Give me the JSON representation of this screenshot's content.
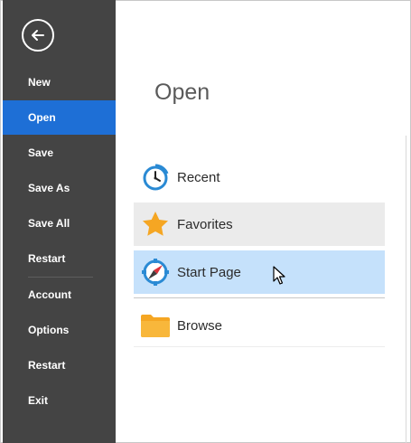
{
  "sidebar": {
    "back_icon": "arrow-left-circle-icon",
    "items": [
      {
        "label": "New",
        "active": false
      },
      {
        "label": "Open",
        "active": true
      },
      {
        "label": "Save",
        "active": false
      },
      {
        "label": "Save As",
        "active": false
      },
      {
        "label": "Save All",
        "active": false
      },
      {
        "label": "Restart",
        "active": false
      },
      {
        "label": "Account",
        "active": false
      },
      {
        "label": "Options",
        "active": false
      },
      {
        "label": "Restart",
        "active": false
      },
      {
        "label": "Exit",
        "active": false
      }
    ]
  },
  "main": {
    "title": "Open",
    "options": [
      {
        "label": "Recent",
        "icon": "clock-icon",
        "state": "normal"
      },
      {
        "label": "Favorites",
        "icon": "star-icon",
        "state": "selected"
      },
      {
        "label": "Start Page",
        "icon": "compass-icon",
        "state": "hovered"
      },
      {
        "label": "Browse",
        "icon": "folder-icon",
        "state": "normal"
      }
    ]
  },
  "colors": {
    "sidebar_bg": "#444444",
    "active_item": "#1e6fd6",
    "selected_row": "#ebebeb",
    "hover_row": "#c5e1fb",
    "star": "#f5a623",
    "folder": "#f5a623",
    "clock": "#2a8ad4"
  }
}
